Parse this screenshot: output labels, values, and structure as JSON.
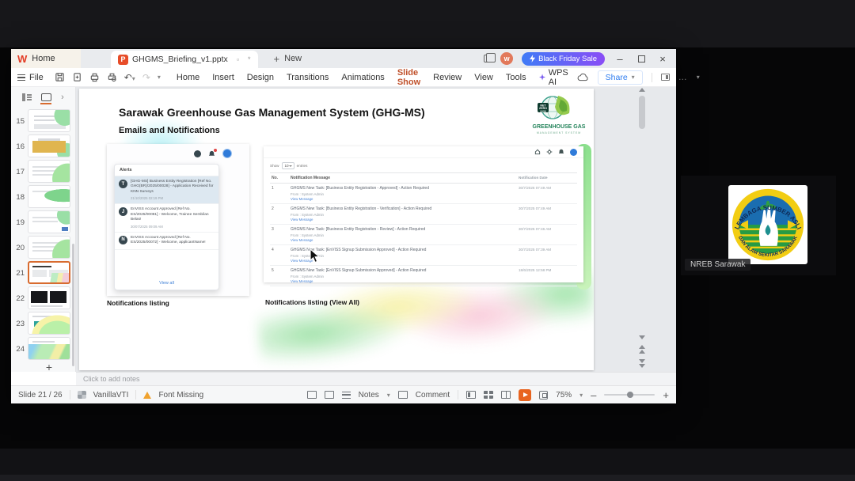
{
  "window": {
    "home_tab": "Home",
    "doc_tab": "GHGMS_Briefing_v1.pptx",
    "modified_mark": "*",
    "new_tab": "New",
    "promo": "Black Friday Sale",
    "avatar_initial": "w",
    "controls": {
      "minimize": "–",
      "close": "×"
    }
  },
  "menubar": {
    "file": "File",
    "items": [
      "Home",
      "Insert",
      "Design",
      "Transitions",
      "Animations",
      "Slide Show",
      "Review",
      "View",
      "Tools"
    ],
    "active_item": "Slide Show",
    "wps_ai": "WPS AI",
    "share": "Share"
  },
  "slide_panel": {
    "slides": [
      {
        "num": "15",
        "variant": "form"
      },
      {
        "num": "16",
        "variant": "yellow"
      },
      {
        "num": "17",
        "variant": "table"
      },
      {
        "num": "18",
        "variant": "leaf"
      },
      {
        "num": "19",
        "variant": "form2"
      },
      {
        "num": "20",
        "variant": "table"
      },
      {
        "num": "21",
        "variant": "current",
        "selected": true
      },
      {
        "num": "22",
        "variant": "dark"
      },
      {
        "num": "23",
        "variant": "wave"
      },
      {
        "num": "24",
        "variant": "wave2"
      }
    ],
    "add_label": "+"
  },
  "slide": {
    "title": "Sarawak Greenhouse Gas Management System (GHG-MS)",
    "subtitle": "Emails and Notifications",
    "logo": {
      "net_zero": [
        "NET",
        "ZERO",
        "2050"
      ],
      "line1": "GREENHOUSE GAS",
      "line2": "MANAGEMENT SYSTEM"
    },
    "alerts_panel": {
      "header": "Alerts",
      "items": [
        {
          "initial": "T",
          "text": "[GHG-MS] Business Entity Registration [Ref No. GHG(BR)/2025/00028] - Application Received for KNN Surveys",
          "time": "21/10/2025 02:19 PM",
          "highlight": true
        },
        {
          "initial": "J",
          "text": "EnVISS Account Approved [Ref No. ES/2025/00081] - Welcome, Trainee Sembilan Belas!",
          "time": "30/07/2025 09:09 AM",
          "highlight": false
        },
        {
          "initial": "N",
          "text": "EnVISS Account Approved [Ref No. ES/2025/00072] - Welcome, applicantName!",
          "time": "",
          "highlight": false
        }
      ],
      "view_all": "View all"
    },
    "table_panel": {
      "show_label": "Show",
      "show_value": "10",
      "entries_label": "entries",
      "headers": [
        "No.",
        "Notification Message",
        "Notification Date"
      ],
      "rows": [
        {
          "no": "1",
          "message": "GHGMS New Task: [Business Entity Registration - Approved] - Action Required",
          "from": "From : System Admin",
          "link": "View Message",
          "date": "30/7/2025 07:49 AM"
        },
        {
          "no": "2",
          "message": "GHGMS New Task: [Business Entity Registration - Verification] - Action Required",
          "from": "From : System Admin",
          "link": "View Message",
          "date": "30/7/2025 07:49 AM"
        },
        {
          "no": "3",
          "message": "GHGMS New Task: [Business Entity Registration - Review] - Action Required",
          "from": "From : System Admin",
          "link": "View Message",
          "date": "30/7/2025 07:46 AM"
        },
        {
          "no": "4",
          "message": "GHGMS New Task: [EnVISS Signup Submission Approved] - Action Required",
          "from": "From : System Admin",
          "link": "View Message",
          "date": "30/7/2025 07:39 AM"
        },
        {
          "no": "5",
          "message": "GHGMS New Task: [EnVISS Signup Submission Approved] - Action Required",
          "from": "From : System Admin",
          "link": "View Message",
          "date": "18/6/2025 12:58 PM"
        }
      ]
    },
    "captions": {
      "left": "Notifications listing",
      "right": "Notifications listing (View All)"
    }
  },
  "notes": {
    "placeholder": "Click to add notes"
  },
  "statusbar": {
    "slide_counter": "Slide 21 / 26",
    "theme": "VanillaVTI",
    "font_missing": "Font Missing",
    "notes": "Notes",
    "comment": "Comment",
    "zoom": "75%"
  },
  "meeting": {
    "participant_name": "NREB Sarawak",
    "logo_text_top": "LEMBAGA SUMBER ASLI",
    "logo_text_bottom": "DAN ALAM SEKITAR SARAWAK"
  },
  "colors": {
    "accent_orange": "#c0512b",
    "promo_gradient": [
      "#3f7bf6",
      "#8a4df6"
    ],
    "link_blue": "#4a86d8",
    "play_orange": "#e8641f"
  }
}
